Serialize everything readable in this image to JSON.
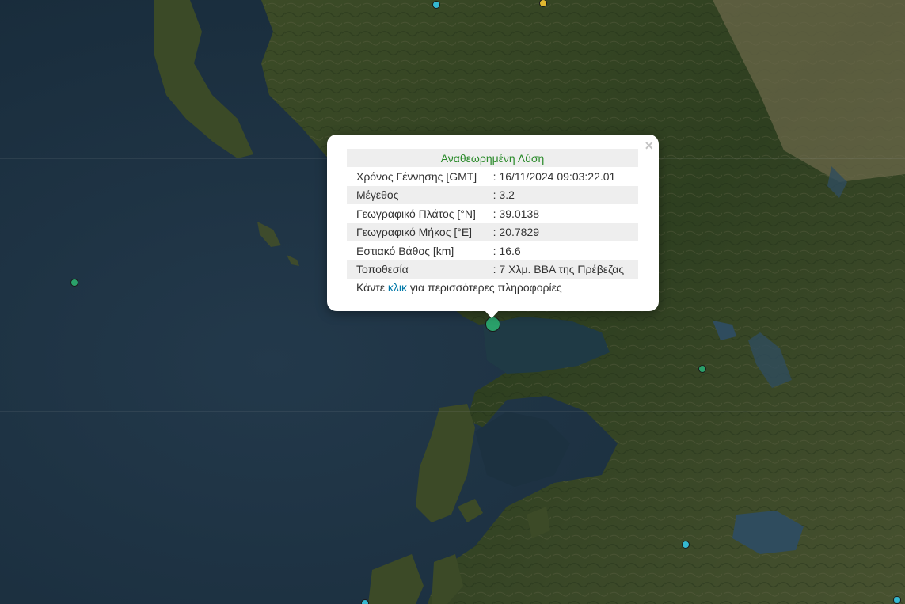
{
  "popup": {
    "title": "Αναθεωρημένη Λύση",
    "close_symbol": "×",
    "rows": [
      {
        "label": "Χρόνος Γέννησης [GMT]",
        "value": ": 16/11/2024 09:03:22.01"
      },
      {
        "label": "Μέγεθος",
        "value": ": 3.2"
      },
      {
        "label": "Γεωγραφικό Πλάτος [°N]",
        "value": ": 39.0138"
      },
      {
        "label": "Γεωγραφικό Μήκος [°E]",
        "value": ": 20.7829"
      },
      {
        "label": "Εστιακό Βάθος [km]",
        "value": ": 16.6"
      },
      {
        "label": "Τοποθεσία",
        "value": ": 7 Χλμ. ΒΒΑ της Πρέβεζας"
      }
    ],
    "more_prefix": "Κάντε ",
    "more_link": "κλικ",
    "more_suffix": " για περισσότερες πληροφορίες"
  },
  "colors": {
    "sea": "#1d3142",
    "land_dark": "#2f4221",
    "land_mid": "#4b5a30",
    "land_light": "#7a7a5c",
    "marker_green": "#2aa06a",
    "marker_cyan": "#35b8d0",
    "marker_yellow": "#e0b830",
    "title_green": "#2a8a2a",
    "link_blue": "#0078a8"
  },
  "markers": [
    {
      "name": "earthquake-marker-cyan",
      "color": "cyan"
    },
    {
      "name": "earthquake-marker-yellow",
      "color": "yellow"
    },
    {
      "name": "earthquake-marker-green",
      "color": "green"
    },
    {
      "name": "earthquake-marker-selected",
      "color": "green"
    },
    {
      "name": "earthquake-marker-green",
      "color": "green"
    },
    {
      "name": "earthquake-marker-cyan",
      "color": "cyan"
    },
    {
      "name": "earthquake-marker-cyan",
      "color": "cyan"
    },
    {
      "name": "earthquake-marker-cyan",
      "color": "cyan"
    }
  ]
}
